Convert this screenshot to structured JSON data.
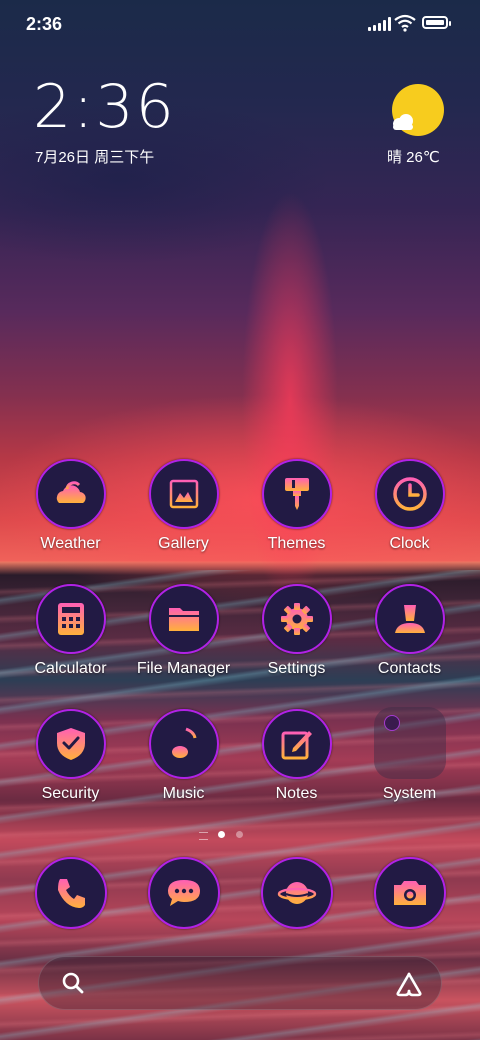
{
  "status_bar": {
    "time": "2:36"
  },
  "clock_widget": {
    "time": "2:36",
    "date": "7月26日 周三下午"
  },
  "weather_widget": {
    "text": "晴 26℃",
    "icon": "sunny-cloud-icon"
  },
  "apps": [
    {
      "label": "Weather",
      "icon": "weather-icon"
    },
    {
      "label": "Gallery",
      "icon": "gallery-icon"
    },
    {
      "label": "Themes",
      "icon": "brush-icon"
    },
    {
      "label": "Clock",
      "icon": "clock-icon"
    },
    {
      "label": "Calculator",
      "icon": "calculator-icon"
    },
    {
      "label": "File Manager",
      "icon": "folder-icon"
    },
    {
      "label": "Settings",
      "icon": "gear-icon"
    },
    {
      "label": "Contacts",
      "icon": "person-icon"
    },
    {
      "label": "Security",
      "icon": "shield-icon"
    },
    {
      "label": "Music",
      "icon": "music-note-icon"
    },
    {
      "label": "Notes",
      "icon": "note-edit-icon"
    },
    {
      "label": "System",
      "icon": "folder-group-icon"
    }
  ],
  "dock": [
    {
      "icon": "phone-icon"
    },
    {
      "icon": "message-icon"
    },
    {
      "icon": "browser-planet-icon"
    },
    {
      "icon": "camera-icon"
    }
  ],
  "pager": {
    "current_page": 1,
    "page_count": 2
  },
  "search_bar": {
    "left_icon": "search-icon",
    "right_icon": "assistant-icon"
  },
  "colors": {
    "icon_gradient_top": "#ff5fb5",
    "icon_gradient_bottom": "#ffb13b",
    "ring": "#b122e6",
    "icon_bg": "#221a44"
  }
}
